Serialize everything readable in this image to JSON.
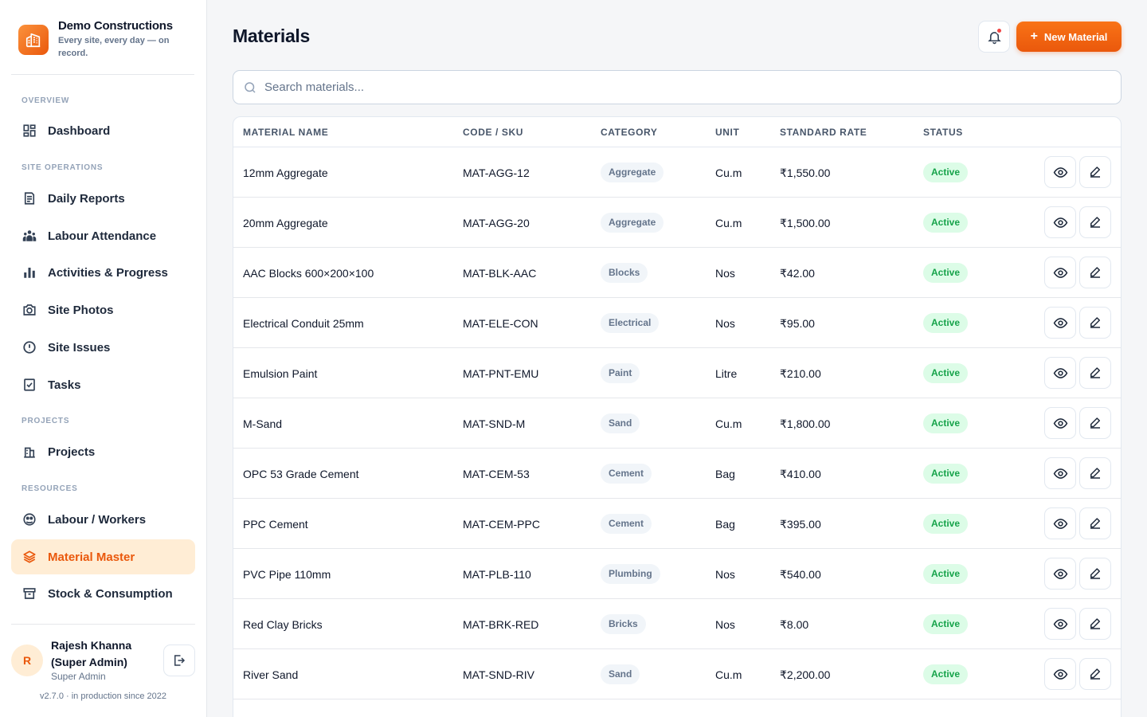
{
  "brand": {
    "name": "Demo Constructions",
    "tagline": "Every site, every day — on record."
  },
  "sidebar": {
    "sections": [
      {
        "label": "OVERVIEW"
      },
      {
        "label": "SITE OPERATIONS"
      },
      {
        "label": "PROJECTS"
      },
      {
        "label": "RESOURCES"
      }
    ],
    "items": [
      {
        "label": "Dashboard",
        "icon": "dashboard-icon"
      },
      {
        "label": "Daily Reports",
        "icon": "report-icon"
      },
      {
        "label": "Labour Attendance",
        "icon": "people-icon"
      },
      {
        "label": "Activities & Progress",
        "icon": "bar-chart-icon"
      },
      {
        "label": "Site Photos",
        "icon": "camera-icon"
      },
      {
        "label": "Site Issues",
        "icon": "alert-circle-icon"
      },
      {
        "label": "Tasks",
        "icon": "checkbox-icon"
      },
      {
        "label": "Projects",
        "icon": "building-icon"
      },
      {
        "label": "Labour / Workers",
        "icon": "workers-icon"
      },
      {
        "label": "Material Master",
        "icon": "layers-icon",
        "active": true
      },
      {
        "label": "Stock & Consumption",
        "icon": "archive-icon"
      }
    ]
  },
  "user": {
    "initial": "R",
    "name": "Rajesh Khanna (Super Admin)",
    "role": "Super Admin",
    "version": "v2.7.0 · in production since 2022"
  },
  "header": {
    "title": "Materials",
    "new_button_label": "New Material"
  },
  "search": {
    "placeholder": "Search materials...",
    "value": ""
  },
  "table": {
    "columns": [
      "MATERIAL NAME",
      "CODE / SKU",
      "CATEGORY",
      "UNIT",
      "STANDARD RATE",
      "STATUS"
    ],
    "rows": [
      {
        "name": "12mm Aggregate",
        "code": "MAT-AGG-12",
        "category": "Aggregate",
        "unit": "Cu.m",
        "rate": "₹1,550.00",
        "status": "Active"
      },
      {
        "name": "20mm Aggregate",
        "code": "MAT-AGG-20",
        "category": "Aggregate",
        "unit": "Cu.m",
        "rate": "₹1,500.00",
        "status": "Active"
      },
      {
        "name": "AAC Blocks 600×200×100",
        "code": "MAT-BLK-AAC",
        "category": "Blocks",
        "unit": "Nos",
        "rate": "₹42.00",
        "status": "Active"
      },
      {
        "name": "Electrical Conduit 25mm",
        "code": "MAT-ELE-CON",
        "category": "Electrical",
        "unit": "Nos",
        "rate": "₹95.00",
        "status": "Active"
      },
      {
        "name": "Emulsion Paint",
        "code": "MAT-PNT-EMU",
        "category": "Paint",
        "unit": "Litre",
        "rate": "₹210.00",
        "status": "Active"
      },
      {
        "name": "M-Sand",
        "code": "MAT-SND-M",
        "category": "Sand",
        "unit": "Cu.m",
        "rate": "₹1,800.00",
        "status": "Active"
      },
      {
        "name": "OPC 53 Grade Cement",
        "code": "MAT-CEM-53",
        "category": "Cement",
        "unit": "Bag",
        "rate": "₹410.00",
        "status": "Active"
      },
      {
        "name": "PPC Cement",
        "code": "MAT-CEM-PPC",
        "category": "Cement",
        "unit": "Bag",
        "rate": "₹395.00",
        "status": "Active"
      },
      {
        "name": "PVC Pipe 110mm",
        "code": "MAT-PLB-110",
        "category": "Plumbing",
        "unit": "Nos",
        "rate": "₹540.00",
        "status": "Active"
      },
      {
        "name": "Red Clay Bricks",
        "code": "MAT-BRK-RED",
        "category": "Bricks",
        "unit": "Nos",
        "rate": "₹8.00",
        "status": "Active"
      },
      {
        "name": "River Sand",
        "code": "MAT-SND-RIV",
        "category": "Sand",
        "unit": "Cu.m",
        "rate": "₹2,200.00",
        "status": "Active"
      }
    ]
  },
  "colors": {
    "accent": "#ea580c",
    "active_bg": "#ffedd5",
    "status_green": "#16a34a"
  }
}
